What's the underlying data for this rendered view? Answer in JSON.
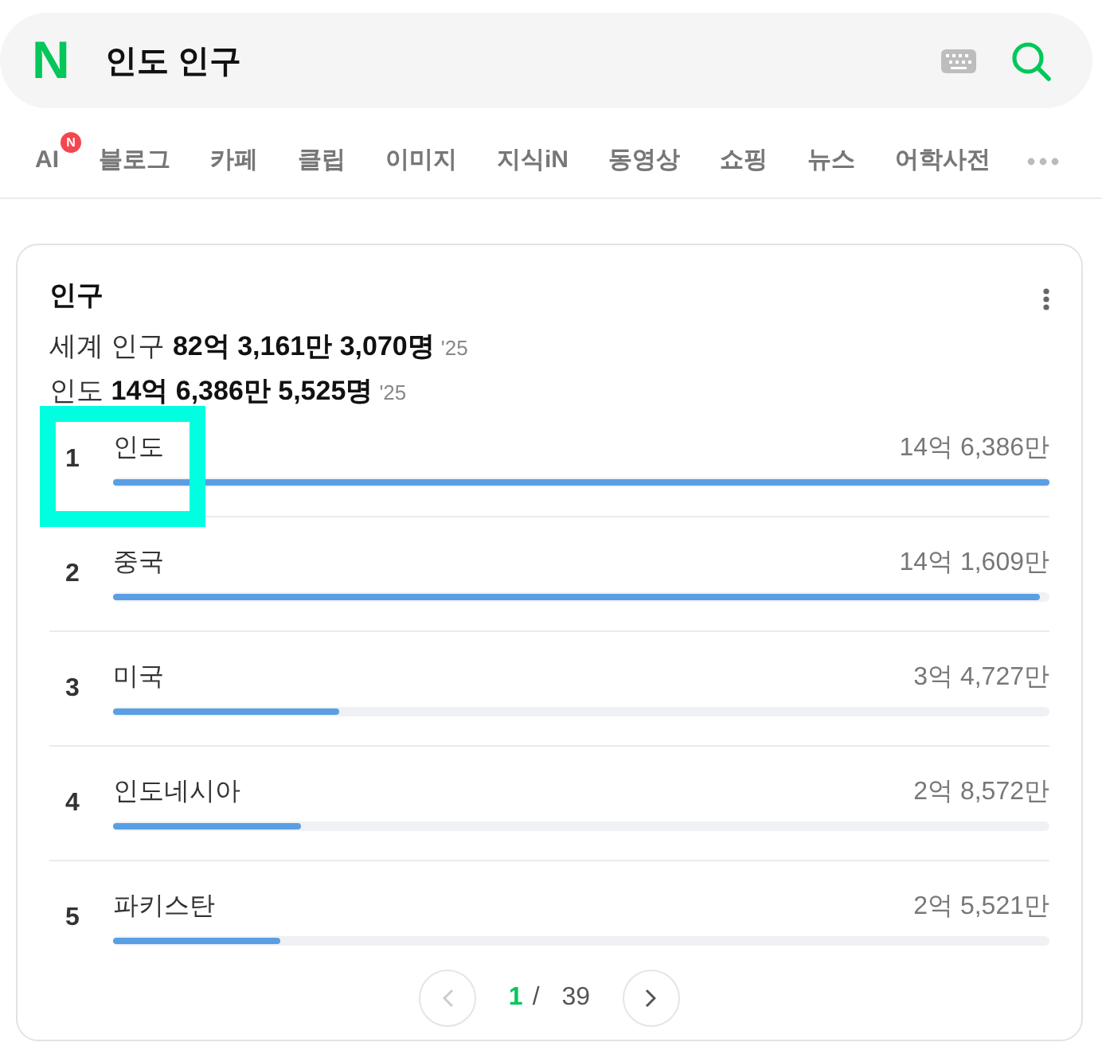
{
  "search": {
    "logo": "N",
    "query": "인도 인구"
  },
  "tabs": [
    {
      "label": "AI",
      "badge": "N",
      "selected": false
    },
    {
      "label": "블로그",
      "selected": false
    },
    {
      "label": "카페",
      "selected": false
    },
    {
      "label": "클립",
      "selected": false
    },
    {
      "label": "이미지",
      "selected": false
    },
    {
      "label": "지식iN",
      "selected": false
    },
    {
      "label": "동영상",
      "selected": false
    },
    {
      "label": "쇼핑",
      "selected": false
    },
    {
      "label": "뉴스",
      "selected": false
    },
    {
      "label": "어학사전",
      "selected": false
    }
  ],
  "card": {
    "title": "인구",
    "summary": [
      {
        "text": "세계 인구 **82억 3,161만 3,070명**",
        "year": "'25"
      },
      {
        "text": "인도 **14억 6,386만 5,525명**",
        "year": "'25"
      }
    ],
    "rows": [
      {
        "rank": "1",
        "name": "인도",
        "value": "14억 6,386만",
        "level": 1,
        "highlighted": true
      },
      {
        "rank": "2",
        "name": "중국",
        "value": "14억 1,609만",
        "level": 0.99,
        "highlighted": false
      },
      {
        "rank": "3",
        "name": "미국",
        "value": "3억 4,727만",
        "level": 0.242,
        "highlighted": false
      },
      {
        "rank": "4",
        "name": "인도네시아",
        "value": "2억 8,572만",
        "level": 0.2,
        "highlighted": false
      },
      {
        "rank": "5",
        "name": "파키스탄",
        "value": "2억 5,521만",
        "level": 0.178,
        "highlighted": false
      }
    ],
    "pagination": {
      "current": "1",
      "separator": "/",
      "total": "39"
    }
  }
}
